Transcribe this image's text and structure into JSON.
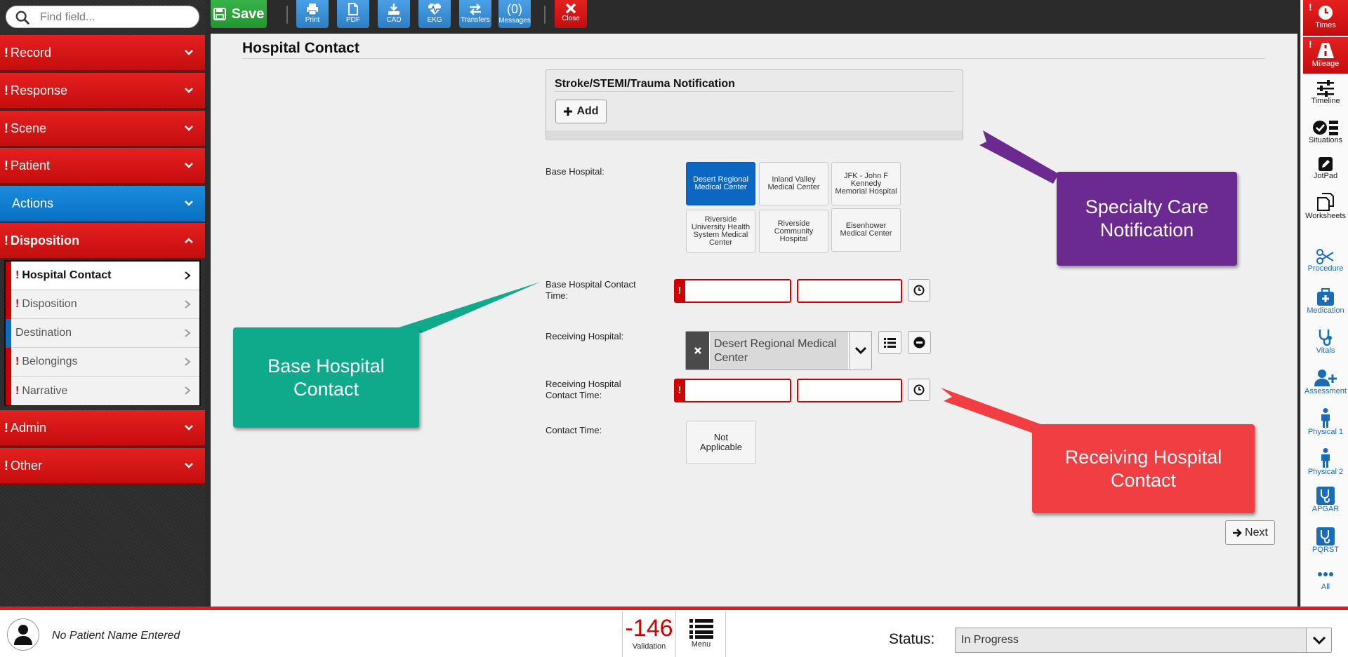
{
  "search": {
    "placeholder": "Find field..."
  },
  "toolbar": {
    "save": "Save",
    "print": "Print",
    "pdf": "PDF",
    "cad": "CAD",
    "ekg": "EKG",
    "transfers": "Transfers",
    "messages_count": "(0)",
    "messages": "Messages",
    "close": "Close"
  },
  "sidebar": {
    "sections": [
      {
        "label": "Record",
        "flag": "!"
      },
      {
        "label": "Response",
        "flag": "!"
      },
      {
        "label": "Scene",
        "flag": "!"
      },
      {
        "label": "Patient",
        "flag": "!"
      },
      {
        "label": "Actions",
        "flag": ""
      },
      {
        "label": "Disposition",
        "flag": "!"
      },
      {
        "label": "Admin",
        "flag": "!"
      },
      {
        "label": "Other",
        "flag": "!"
      }
    ],
    "subitems": [
      {
        "label": "Hospital Contact",
        "flag": "!"
      },
      {
        "label": "Disposition",
        "flag": "!"
      },
      {
        "label": "Destination",
        "flag": ""
      },
      {
        "label": "Belongings",
        "flag": "!"
      },
      {
        "label": "Narrative",
        "flag": "!"
      }
    ]
  },
  "page": {
    "title": "Hospital Contact",
    "notification": {
      "title": "Stroke/STEMI/Trauma Notification",
      "add": "Add"
    },
    "base_hospital_label": "Base Hospital:",
    "base_hospitals": [
      "Desert Regional Medical Center",
      "Inland Valley Medical Center",
      "JFK - John F Kennedy Memorial Hospital",
      "Riverside University Health System Medical Center",
      "Riverside Community Hospital",
      "Eisenhower Medical Center"
    ],
    "base_contact_time_label": "Base Hospital Contact Time:",
    "receiving_hospital_label": "Receiving Hospital:",
    "receiving_hospital_value": "Desert Regional Medical Center",
    "receiving_contact_time_label": "Receiving Hospital Contact Time:",
    "contact_time_label": "Contact Time:",
    "not_applicable": "Not Applicable",
    "next": "Next",
    "required_flag": "!"
  },
  "callouts": {
    "specialty": "Specialty Care Notification",
    "base": "Base Hospital Contact",
    "receiving": "Receiving Hospital Contact"
  },
  "rightbar": {
    "items": [
      "Times",
      "Mileage",
      "Timeline",
      "Situations",
      "JotPad",
      "Worksheets",
      "Procedure",
      "Medication",
      "Vitals",
      "Assessment",
      "Physical 1",
      "Physical 2",
      "APGAR",
      "PQRST",
      "All"
    ]
  },
  "footer": {
    "patient": "No Patient Name Entered",
    "validation_count": "-146",
    "validation_label": "Validation",
    "menu_label": "Menu",
    "status_label": "Status:",
    "status_value": "In Progress"
  },
  "colors": {
    "nav_red": "#d8141a",
    "nav_blue": "#0e77cc",
    "selected_hospital": "#0b67c2",
    "callout_purple": "#6a2a8f",
    "callout_teal": "#0faa8c",
    "callout_red": "#f03e42",
    "save_green": "#2ea73d"
  }
}
